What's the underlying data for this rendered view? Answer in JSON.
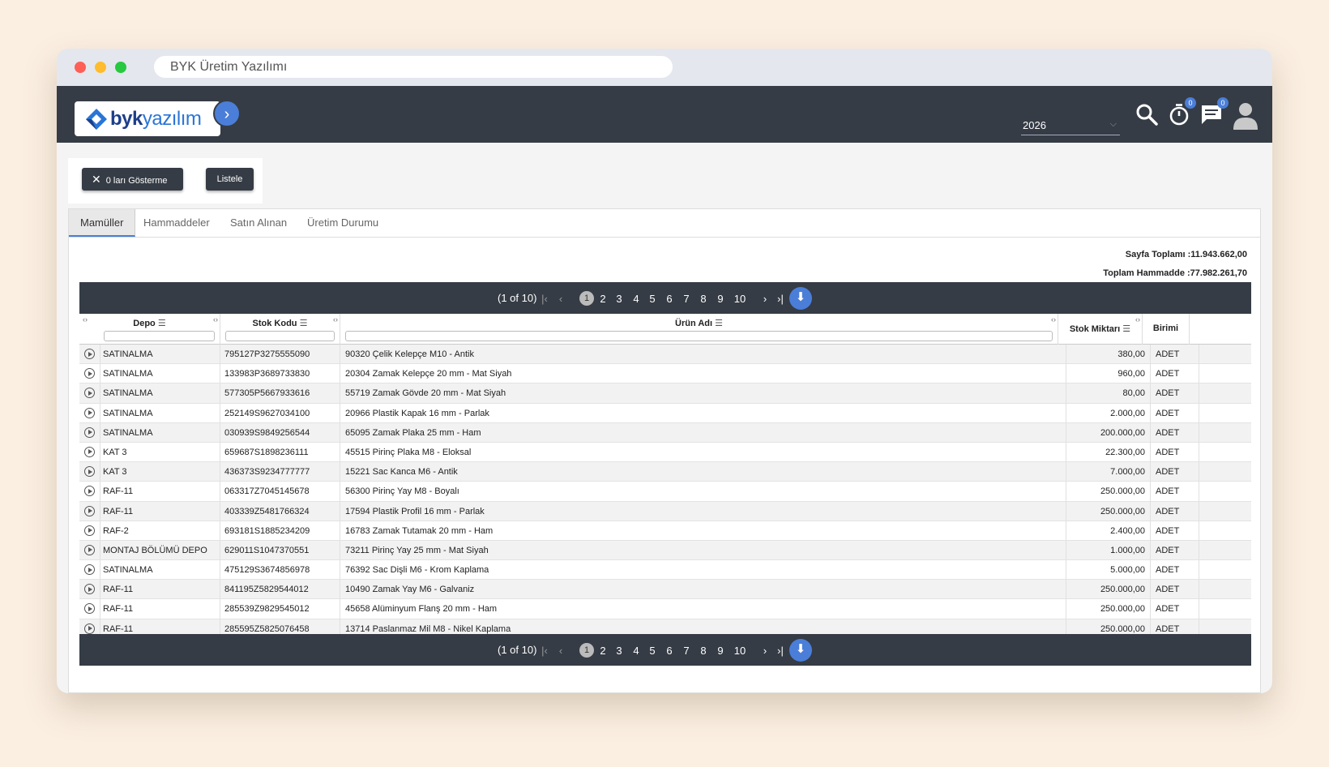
{
  "browser": {
    "url_title": "BYK Üretim Yazılımı"
  },
  "header": {
    "logo_text_bold": "byk",
    "logo_text_light": "yazılım",
    "year": "2026",
    "timer_badge": "0",
    "messages_badge": "0"
  },
  "toolbar": {
    "hide_zero_label": "0 ları Gösterme",
    "list_label": "Listele"
  },
  "tabs": [
    {
      "label": "Mamüller",
      "active": true
    },
    {
      "label": "Hammaddeler",
      "active": false
    },
    {
      "label": "Satın Alınan",
      "active": false
    },
    {
      "label": "Üretim Durumu",
      "active": false
    }
  ],
  "totals": {
    "page_total": "Sayfa Toplamı :11.943.662,00",
    "raw_total": "Toplam Hammadde :77.982.261,70"
  },
  "pager": {
    "info": "(1 of 10)",
    "pages": [
      "1",
      "2",
      "3",
      "4",
      "5",
      "6",
      "7",
      "8",
      "9",
      "10"
    ]
  },
  "table": {
    "columns": [
      "Depo",
      "Stok Kodu",
      "Ürün Adı",
      "Stok Miktarı",
      "Birimi"
    ],
    "rows": [
      [
        "SATINALMA",
        "795127P3275555090",
        "90320 Çelik Kelepçe M10 - Antik",
        "380,00",
        "ADET"
      ],
      [
        "SATINALMA",
        "133983P3689733830",
        "20304 Zamak Kelepçe 20 mm - Mat Siyah",
        "960,00",
        "ADET"
      ],
      [
        "SATINALMA",
        "577305P5667933616",
        "55719 Zamak Gövde 20 mm - Mat Siyah",
        "80,00",
        "ADET"
      ],
      [
        "SATINALMA",
        "252149S9627034100",
        "20966 Plastik Kapak 16 mm - Parlak",
        "2.000,00",
        "ADET"
      ],
      [
        "SATINALMA",
        "030939S9849256544",
        "65095 Zamak Plaka 25 mm - Ham",
        "200.000,00",
        "ADET"
      ],
      [
        "KAT 3",
        "659687S1898236111",
        "45515 Pirinç Plaka M8 - Eloksal",
        "22.300,00",
        "ADET"
      ],
      [
        "KAT 3",
        "436373S9234777777",
        "15221 Sac Kanca M6 - Antik",
        "7.000,00",
        "ADET"
      ],
      [
        "RAF-11",
        "063317Z7045145678",
        "56300 Pirinç Yay M8 - Boyalı",
        "250.000,00",
        "ADET"
      ],
      [
        "RAF-11",
        "403339Z5481766324",
        "17594 Plastik Profil 16 mm - Parlak",
        "250.000,00",
        "ADET"
      ],
      [
        "RAF-2",
        "693181S1885234209",
        "16783 Zamak Tutamak 20 mm - Ham",
        "2.400,00",
        "ADET"
      ],
      [
        "MONTAJ BÖLÜMÜ DEPO",
        "629011S1047370551",
        "73211 Pirinç Yay 25 mm - Mat Siyah",
        "1.000,00",
        "ADET"
      ],
      [
        "SATINALMA",
        "475129S3674856978",
        "76392 Sac Dişli M6 - Krom Kaplama",
        "5.000,00",
        "ADET"
      ],
      [
        "RAF-11",
        "841195Z5829544012",
        "10490 Zamak Yay M6 - Galvaniz",
        "250.000,00",
        "ADET"
      ],
      [
        "RAF-11",
        "285539Z9829545012",
        "45658 Alüminyum Flanş 20 mm - Ham",
        "250.000,00",
        "ADET"
      ],
      [
        "RAF-11",
        "285595Z5825076458",
        "13714 Paslanmaz Mil M8 - Nikel Kaplama",
        "250.000,00",
        "ADET"
      ]
    ]
  },
  "icons": [
    "chevron-right-icon",
    "search-icon",
    "timer-icon",
    "message-icon",
    "user-avatar-icon",
    "close-icon",
    "sort-icon",
    "expand-row-icon",
    "download-icon"
  ]
}
